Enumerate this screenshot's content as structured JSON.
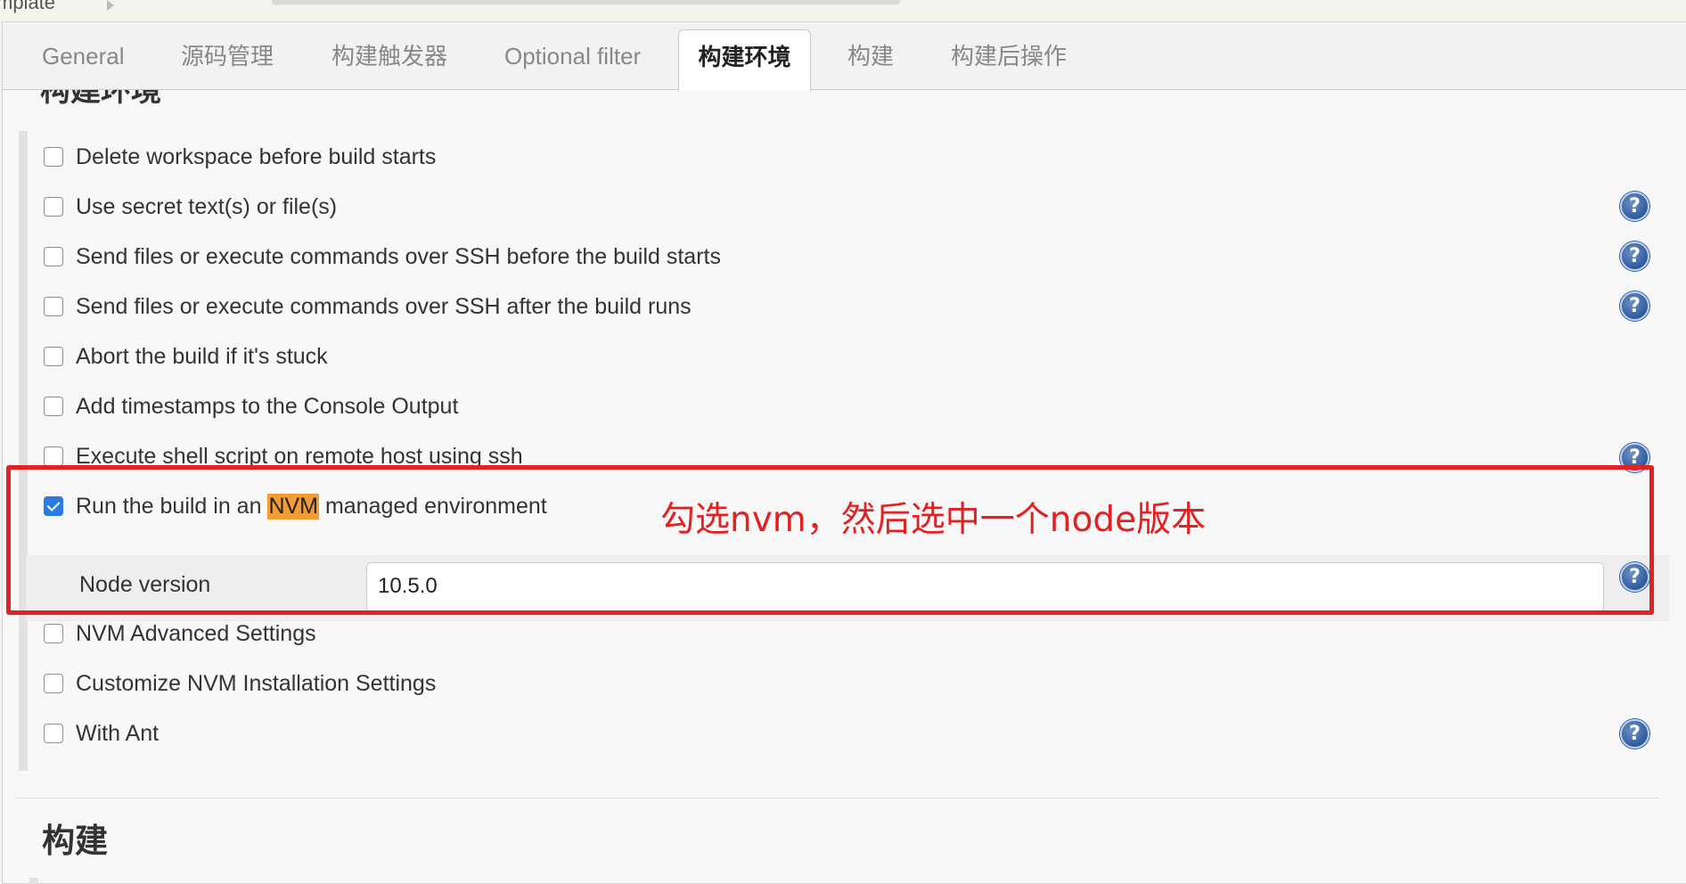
{
  "breadcrumb": {
    "text": "mplate"
  },
  "tabs": [
    {
      "label": "General"
    },
    {
      "label": "源码管理"
    },
    {
      "label": "构建触发器"
    },
    {
      "label": "Optional filter"
    },
    {
      "label": "构建环境"
    },
    {
      "label": "构建"
    },
    {
      "label": "构建后操作"
    }
  ],
  "active_tab": "构建环境",
  "section_heading_cut": "构建环境",
  "options": [
    {
      "label": "Delete workspace before build starts",
      "checked": false,
      "help": false
    },
    {
      "label": "Use secret text(s) or file(s)",
      "checked": false,
      "help": true
    },
    {
      "label": "Send files or execute commands over SSH before the build starts",
      "checked": false,
      "help": true
    },
    {
      "label": "Send files or execute commands over SSH after the build runs",
      "checked": false,
      "help": true
    },
    {
      "label": "Abort the build if it's stuck",
      "checked": false,
      "help": false
    },
    {
      "label": "Add timestamps to the Console Output",
      "checked": false,
      "help": false
    },
    {
      "label": "Execute shell script on remote host using ssh",
      "checked": false,
      "help": true
    },
    {
      "label_pre": "Run the build in an ",
      "label_highlight": "NVM",
      "label_post": " managed environment",
      "checked": true,
      "help": false
    },
    {
      "label": "NVM Advanced Settings",
      "checked": false,
      "help": false
    },
    {
      "label": "Customize NVM Installation Settings",
      "checked": false,
      "help": false
    },
    {
      "label": "With Ant",
      "checked": false,
      "help": true
    }
  ],
  "node_version": {
    "label": "Node version",
    "value": "10.5.0"
  },
  "help_icon_glyph": "?",
  "annotation": {
    "text": "勾选nvm，然后选中一个node版本",
    "color": "#e02222"
  },
  "next_section": {
    "heading": "构建"
  },
  "colors": {
    "accent_checkbox": "#2b7ae5",
    "highlight": "#f39c35",
    "help_icon": "#2f5a9e",
    "danger_button": "#d24939"
  }
}
